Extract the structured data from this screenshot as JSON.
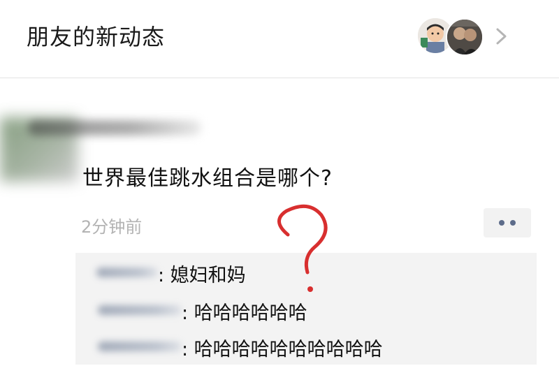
{
  "header": {
    "title": "朋友的新动态"
  },
  "post": {
    "text": "世界最佳跳水组合是哪个?",
    "time": "2分钟前"
  },
  "comments": [
    {
      "text": ": 媳妇和妈"
    },
    {
      "text": ": 哈哈哈哈哈哈"
    },
    {
      "text": ": 哈哈哈哈哈哈哈哈哈哈"
    }
  ],
  "colors": {
    "question_mark": "#d82f2f",
    "more_dots": "#5d6c8a",
    "time_gray": "#b3b3b3"
  }
}
